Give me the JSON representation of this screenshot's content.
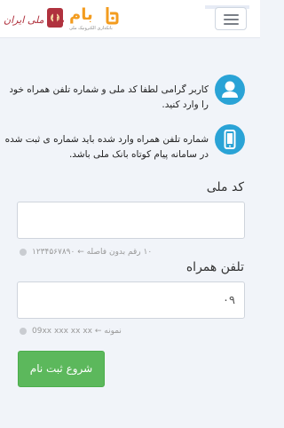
{
  "header": {
    "bank_logo_text": "بانک ملی ایران",
    "bam_logo_text": "بام",
    "bam_logo_subtitle": "بانکداری الکترونیک ملی"
  },
  "info": {
    "line1": "کاربر گرامی لطفا کد ملی و شماره تلفن همراه خود را وارد کنید.",
    "line2": "شماره تلفن همراه وارد شده باید شماره ی ثبت شده در سامانه پیام کوتاه بانک ملی باشد."
  },
  "form": {
    "national_code_label": "کد ملی",
    "national_code_value": "",
    "national_code_hint": "۱۰ رقم بدون فاصله ← ۱۲۳۴۵۶۷۸۹۰",
    "mobile_label": "تلفن همراه",
    "mobile_value": "۰۹",
    "mobile_hint": "نمونه ← 09xx xxx xx xx",
    "submit_label": "شروع ثبت نام"
  },
  "colors": {
    "accent_blue": "#2aa3d6",
    "submit_green": "#5cb85c",
    "bam_orange": "#f39c1f",
    "bank_red": "#b0323e"
  }
}
